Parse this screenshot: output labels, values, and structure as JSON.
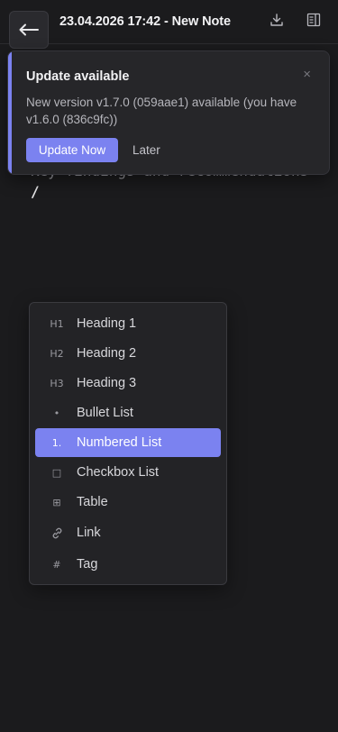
{
  "header": {
    "title": "23.04.2026 17:42 - New Note",
    "back_icon": "arrow-left-icon",
    "download_icon": "download-icon",
    "panel_icon": "sidebar-panel-icon"
  },
  "editor": {
    "line1": "Key findings and recommendations",
    "line2": "/"
  },
  "toast": {
    "title": "Update available",
    "message": "New version v1.7.0 (059aae1) available (you have v1.6.0 (836c9fc))",
    "close": "×",
    "primary_label": "Update Now",
    "secondary_label": "Later",
    "accent_color": "#7b82f0"
  },
  "menu": {
    "selected_index": 4,
    "items": [
      {
        "icon": "H1",
        "label": "Heading 1"
      },
      {
        "icon": "H2",
        "label": "Heading 2"
      },
      {
        "icon": "H3",
        "label": "Heading 3"
      },
      {
        "icon": "•",
        "label": "Bullet List"
      },
      {
        "icon": "1.",
        "label": "Numbered List"
      },
      {
        "icon": "□",
        "label": "Checkbox List"
      },
      {
        "icon": "⊞",
        "label": "Table"
      },
      {
        "icon": "link",
        "label": "Link"
      },
      {
        "icon": "#",
        "label": "Tag"
      }
    ]
  }
}
